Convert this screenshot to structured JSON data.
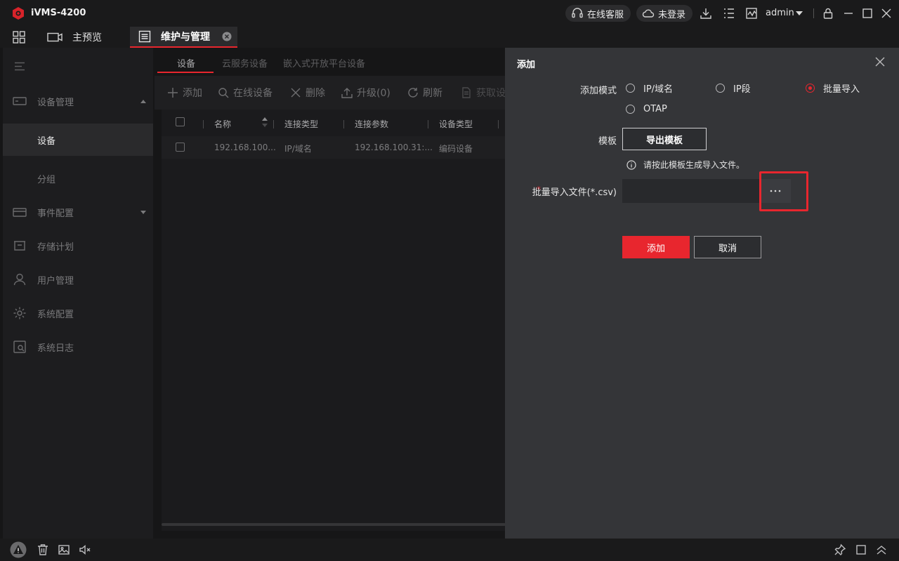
{
  "app": {
    "title": "iVMS-4200"
  },
  "titlebar": {
    "service_label": "在线客服",
    "login_label": "未登录",
    "user_label": "admin",
    "icons": [
      "headset-icon",
      "cloud-icon",
      "download-icon",
      "task-list-icon",
      "monitor-icon",
      "caret-down-icon",
      "lock-icon",
      "minimize-icon",
      "maximize-icon",
      "close-icon"
    ]
  },
  "tabs": [
    {
      "label": "主预览",
      "icon": "preview-icon"
    },
    {
      "label": "维护与管理",
      "icon": "maintenance-icon",
      "active": true
    }
  ],
  "sidebar": {
    "items": [
      {
        "label": "设备管理",
        "icon": "device-icon",
        "expanded": true
      },
      {
        "label": "设备",
        "selected": true
      },
      {
        "label": "分组"
      },
      {
        "label": "事件配置",
        "icon": "event-icon"
      },
      {
        "label": "存储计划",
        "icon": "storage-icon"
      },
      {
        "label": "用户管理",
        "icon": "user-icon"
      },
      {
        "label": "系统配置",
        "icon": "settings-icon"
      },
      {
        "label": "系统日志",
        "icon": "log-icon"
      }
    ]
  },
  "main": {
    "subtabs": [
      "设备",
      "云服务设备",
      "嵌入式开放平台设备"
    ],
    "toolbar": {
      "add": "添加",
      "online": "在线设备",
      "delete": "删除",
      "upgrade": "升级(0)",
      "refresh": "刷新",
      "fetch": "获取设"
    },
    "table": {
      "headers": [
        "名称",
        "连接类型",
        "连接参数",
        "设备类型"
      ],
      "rows": [
        [
          "192.168.100...",
          "IP/域名",
          "192.168.100.31:...",
          "编码设备"
        ]
      ]
    }
  },
  "dialog": {
    "title": "添加",
    "mode_label": "添加模式",
    "modes": [
      {
        "label": "IP/域名",
        "checked": false
      },
      {
        "label": "IP段",
        "checked": false
      },
      {
        "label": "批量导入",
        "checked": true
      },
      {
        "label": "OTAP",
        "checked": false
      }
    ],
    "template_label": "模板",
    "export_button": "导出模板",
    "hint": "请按此模板生成导入文件。",
    "file_label": "批量导入文件(*.csv)",
    "file_value": "",
    "required_mark": "*",
    "add_button": "添加",
    "cancel_button": "取消"
  },
  "colors": {
    "accent": "#e8262e",
    "background": "#161617",
    "dialog": "#343538"
  }
}
